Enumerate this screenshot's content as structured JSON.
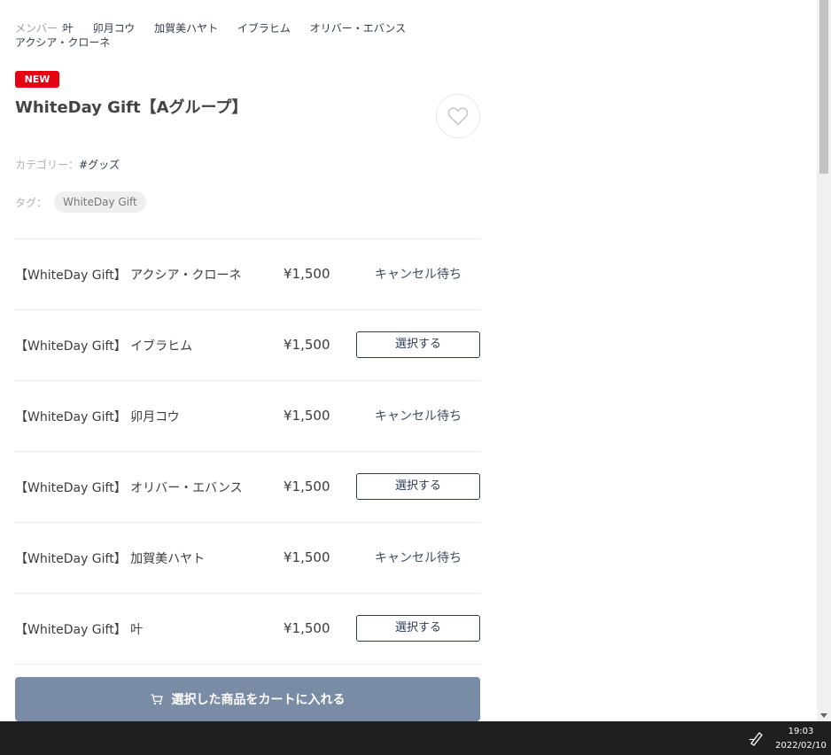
{
  "members": {
    "label": "メンバー :",
    "names": [
      "叶",
      "卯月コウ",
      "加賀美ハヤト",
      "イブラヒム",
      "オリバー・エバンス",
      "アクシア・クローネ"
    ]
  },
  "product": {
    "badge": "NEW",
    "title": "WhiteDay Gift【Aグループ】",
    "category_label": "カテゴリー：",
    "category_value": "#グッズ",
    "tag_label": "タグ：",
    "tag_value": "WhiteDay Gift"
  },
  "items": [
    {
      "name": "【WhiteDay Gift】 アクシア・クローネ",
      "price": "¥1,500",
      "status": "キャンセル待ち"
    },
    {
      "name": "【WhiteDay Gift】 イブラヒム",
      "price": "¥1,500",
      "status": "選択する"
    },
    {
      "name": "【WhiteDay Gift】 卯月コウ",
      "price": "¥1,500",
      "status": "キャンセル待ち"
    },
    {
      "name": "【WhiteDay Gift】 オリバー・エバンス",
      "price": "¥1,500",
      "status": "選択する"
    },
    {
      "name": "【WhiteDay Gift】 加賀美ハヤト",
      "price": "¥1,500",
      "status": "キャンセル待ち"
    },
    {
      "name": "【WhiteDay Gift】 叶",
      "price": "¥1,500",
      "status": "選択する"
    }
  ],
  "cart": {
    "label": "選択した商品をカートに入れる",
    "icon": "cart-icon"
  },
  "colors": {
    "badge": "#e60012",
    "cart_button": "#7a8ca5",
    "select_border": "#2c3d5a"
  },
  "taskbar": {
    "time": "19:03",
    "date": "2022/02/10",
    "icon": "pen-icon"
  }
}
